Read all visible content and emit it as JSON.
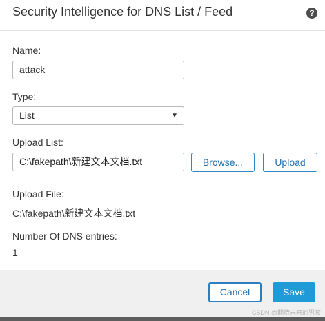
{
  "dialog": {
    "title": "Security Intelligence for DNS List / Feed",
    "help_icon_glyph": "?"
  },
  "form": {
    "name_label": "Name:",
    "name_value": "attack",
    "type_label": "Type:",
    "type_value": "List",
    "upload_list_label": "Upload List:",
    "upload_list_value": "C:\\fakepath\\新建文本文档.txt",
    "browse_label": "Browse...",
    "upload_label": "Upload",
    "upload_file_label": "Upload File:",
    "upload_file_value": "C:\\fakepath\\新建文本文档.txt",
    "dns_entries_label": "Number Of DNS entries:",
    "dns_entries_value": "1"
  },
  "footer": {
    "cancel_label": "Cancel",
    "save_label": "Save"
  },
  "watermark": "CSDN @期待未来的男孩",
  "icons": {
    "help": "question-circle-icon",
    "select_caret": "caret-down-icon"
  },
  "colors": {
    "accent": "#1e9ad6",
    "outline_button": "#2f86c7",
    "footer_bg": "#f0f0f0"
  }
}
